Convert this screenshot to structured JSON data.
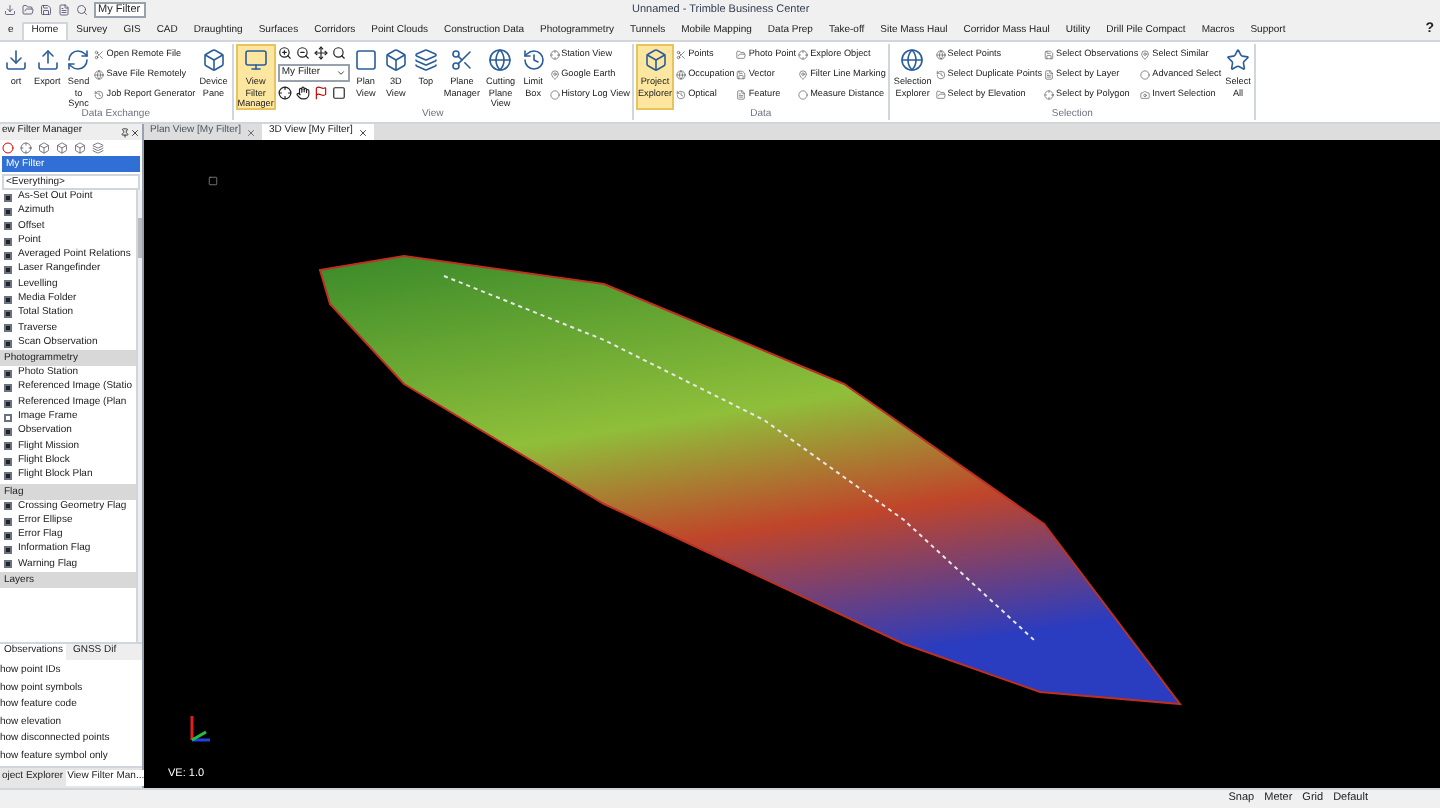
{
  "quick_access": {
    "filter": "My Filter"
  },
  "window": {
    "title": "Unnamed - Trimble Business Center",
    "help": "?"
  },
  "ribbon_tabs": [
    {
      "label": "e",
      "selected": false
    },
    {
      "label": "Home",
      "selected": true
    },
    {
      "label": "Survey",
      "selected": false
    },
    {
      "label": "GIS",
      "selected": false
    },
    {
      "label": "CAD",
      "selected": false
    },
    {
      "label": "Draughting",
      "selected": false
    },
    {
      "label": "Surfaces",
      "selected": false
    },
    {
      "label": "Corridors",
      "selected": false
    },
    {
      "label": "Point Clouds",
      "selected": false
    },
    {
      "label": "Construction Data",
      "selected": false
    },
    {
      "label": "Photogrammetry",
      "selected": false
    },
    {
      "label": "Tunnels",
      "selected": false
    },
    {
      "label": "Mobile Mapping",
      "selected": false
    },
    {
      "label": "Data Prep",
      "selected": false
    },
    {
      "label": "Take-off",
      "selected": false
    },
    {
      "label": "Site Mass Haul",
      "selected": false
    },
    {
      "label": "Corridor Mass Haul",
      "selected": false
    },
    {
      "label": "Utility",
      "selected": false
    },
    {
      "label": "Drill Pile Compact",
      "selected": false
    },
    {
      "label": "Macros",
      "selected": false
    },
    {
      "label": "Support",
      "selected": false
    }
  ],
  "ribbon_groups": [
    {
      "label": "Data Exchange",
      "items": [
        {
          "kind": "big",
          "label": "ort",
          "selected": false
        },
        {
          "kind": "big",
          "label": "Export",
          "selected": false
        },
        {
          "kind": "big",
          "label": "Send to Sync",
          "selected": false
        },
        {
          "kind": "small",
          "label": "Open Remote File",
          "selected": false
        },
        {
          "kind": "small",
          "label": "Save File Remotely",
          "selected": false
        },
        {
          "kind": "small",
          "label": "Job Report Generator",
          "selected": false
        },
        {
          "kind": "big",
          "label": "Device Pane",
          "selected": false
        }
      ]
    },
    {
      "label": "View",
      "items": [
        {
          "kind": "big",
          "label": "View Filter Manager",
          "selected": true
        },
        {
          "kind": "filter",
          "label": "My Filter",
          "selected": false
        },
        {
          "kind": "big",
          "label": "Plan View",
          "selected": false
        },
        {
          "kind": "big",
          "label": "3D View",
          "selected": false
        },
        {
          "kind": "big",
          "label": "Top",
          "selected": false
        },
        {
          "kind": "big",
          "label": "Plane Manager",
          "selected": false
        },
        {
          "kind": "big",
          "label": "Cutting Plane View",
          "selected": false
        },
        {
          "kind": "big",
          "label": "Limit Box",
          "selected": false
        },
        {
          "kind": "small",
          "label": "Station View",
          "selected": false
        },
        {
          "kind": "small",
          "label": "Google Earth",
          "selected": false
        },
        {
          "kind": "small",
          "label": "History Log View",
          "selected": false
        }
      ]
    },
    {
      "label": "Data",
      "items": [
        {
          "kind": "big",
          "label": "Project Explorer",
          "selected": true
        },
        {
          "kind": "small",
          "label": "Points",
          "selected": false
        },
        {
          "kind": "small",
          "label": "Occupation",
          "selected": false
        },
        {
          "kind": "small",
          "label": "Optical",
          "selected": false
        },
        {
          "kind": "small",
          "label": "Photo Point",
          "selected": false
        },
        {
          "kind": "small",
          "label": "Vector",
          "selected": false
        },
        {
          "kind": "small",
          "label": "Feature",
          "selected": false
        },
        {
          "kind": "small",
          "label": "Explore Object",
          "selected": false
        },
        {
          "kind": "small",
          "label": "Filter Line Marking",
          "selected": false
        },
        {
          "kind": "small",
          "label": "Measure Distance",
          "selected": false
        }
      ]
    },
    {
      "label": "Selection",
      "items": [
        {
          "kind": "big",
          "label": "Selection Explorer",
          "selected": false
        },
        {
          "kind": "small",
          "label": "Select Points",
          "selected": false
        },
        {
          "kind": "small",
          "label": "Select Duplicate Points",
          "selected": false
        },
        {
          "kind": "small",
          "label": "Select by Elevation",
          "selected": false
        },
        {
          "kind": "small",
          "label": "Select Observations",
          "selected": false
        },
        {
          "kind": "small",
          "label": "Select by Layer",
          "selected": false
        },
        {
          "kind": "small",
          "label": "Select by Polygon",
          "selected": false
        },
        {
          "kind": "small",
          "label": "Select Similar",
          "selected": false
        },
        {
          "kind": "small",
          "label": "Advanced Select",
          "selected": false
        },
        {
          "kind": "small",
          "label": "Invert Selection",
          "selected": false
        },
        {
          "kind": "big",
          "label": "Select All",
          "selected": false
        }
      ]
    }
  ],
  "filter_panel": {
    "title": "ew Filter Manager",
    "filter": "My Filter",
    "scope": "<Everything>",
    "list": [
      {
        "kind": "item",
        "label": "As-Set Out Point",
        "checked": true
      },
      {
        "kind": "item",
        "label": "Azimuth",
        "checked": true
      },
      {
        "kind": "item",
        "label": "Offset",
        "checked": true
      },
      {
        "kind": "item",
        "label": "Point",
        "checked": true
      },
      {
        "kind": "item",
        "label": "Averaged Point Relations",
        "checked": true
      },
      {
        "kind": "item",
        "label": "Laser Rangefinder",
        "checked": true
      },
      {
        "kind": "item",
        "label": "Levelling",
        "checked": true
      },
      {
        "kind": "item",
        "label": "Media Folder",
        "checked": true
      },
      {
        "kind": "item",
        "label": "Total Station",
        "checked": true
      },
      {
        "kind": "item",
        "label": "Traverse",
        "checked": true
      },
      {
        "kind": "item",
        "label": "Scan Observation",
        "checked": true
      },
      {
        "kind": "heading",
        "label": "Photogrammetry"
      },
      {
        "kind": "item",
        "label": "Photo Station",
        "checked": true
      },
      {
        "kind": "item",
        "label": "Referenced Image (Statio",
        "checked": true
      },
      {
        "kind": "item",
        "label": "Referenced Image (Plan",
        "checked": true
      },
      {
        "kind": "item",
        "label": "Image Frame",
        "checked": false
      },
      {
        "kind": "item",
        "label": "Observation",
        "checked": true
      },
      {
        "kind": "item",
        "label": "Flight Mission",
        "checked": true
      },
      {
        "kind": "item",
        "label": "Flight Block",
        "checked": true
      },
      {
        "kind": "item",
        "label": "Flight Block Plan",
        "checked": true
      },
      {
        "kind": "heading",
        "label": "Flag"
      },
      {
        "kind": "item",
        "label": "Crossing Geometry Flag",
        "checked": true
      },
      {
        "kind": "item",
        "label": "Error Ellipse",
        "checked": true
      },
      {
        "kind": "item",
        "label": "Error Flag",
        "checked": true
      },
      {
        "kind": "item",
        "label": "Information Flag",
        "checked": true
      },
      {
        "kind": "item",
        "label": "Warning Flag",
        "checked": true
      },
      {
        "kind": "heading",
        "label": "Layers"
      }
    ],
    "tabs": [
      {
        "label": "Observations",
        "selected": true
      },
      {
        "label": "GNSS Dif",
        "selected": false
      }
    ],
    "options": [
      "how point IDs",
      "how point symbols",
      "how feature code",
      "how elevation",
      "how disconnected points",
      "how feature symbol only"
    ],
    "bottom_tabs": [
      {
        "label": "oject Explorer",
        "selected": false
      },
      {
        "label": "View Filter Man...",
        "selected": true
      }
    ]
  },
  "view_tabs": [
    {
      "label": "Plan View [My Filter]",
      "selected": false
    },
    {
      "label": "3D View [My Filter]",
      "selected": true
    }
  ],
  "view": {
    "exaggeration": "VE: 1.0"
  },
  "status_bar": [
    "Snap",
    "Meter",
    "Grid",
    "Default"
  ]
}
